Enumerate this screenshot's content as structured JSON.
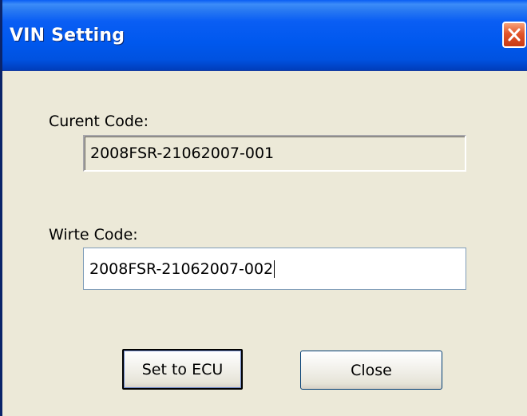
{
  "window": {
    "title": "VIN Setting"
  },
  "current_code": {
    "label": "Curent Code:",
    "value": "2008FSR-21062007-001"
  },
  "write_code": {
    "label": "Wirte Code:",
    "value": "2008FSR-21062007-002"
  },
  "buttons": {
    "set_label": "Set to ECU",
    "close_label": "Close"
  },
  "icons": {
    "close": "close-icon"
  },
  "colors": {
    "titlebar": "#0058ee",
    "face": "#ece9d8",
    "close_button": "#e2552a"
  }
}
